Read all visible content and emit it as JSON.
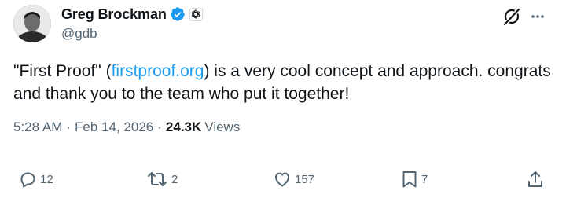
{
  "author": {
    "display_name": "Greg Brockman",
    "handle": "@gdb",
    "verified_icon": "verified-badge-icon",
    "affiliate_icon": "openai-logo-icon"
  },
  "tweet": {
    "text_before_link": "\"First Proof\" (",
    "link_text": "firstproof.org",
    "text_after_link": ") is a very cool concept and approach. congrats and thank you to the team who put it together!",
    "time": "5:28 AM",
    "separator": "·",
    "date": "Feb 14, 2026",
    "views_count": "24.3K",
    "views_label": "Views"
  },
  "actions": {
    "replies": "12",
    "reposts": "2",
    "likes": "157",
    "bookmarks": "7"
  },
  "colors": {
    "link": "#1d9bf0",
    "secondary_text": "#536471",
    "primary_text": "#0f1419",
    "verified": "#1d9bf0"
  }
}
